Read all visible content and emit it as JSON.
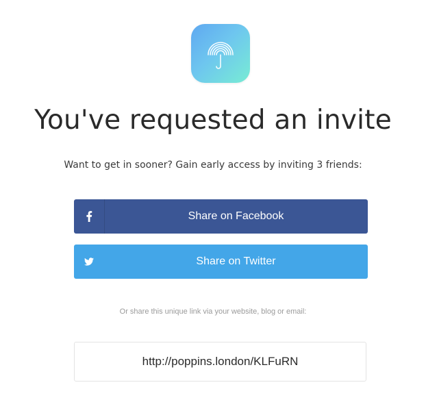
{
  "app": {
    "icon": "umbrella-signal-icon",
    "accent_gradient": [
      "#5fa8f0",
      "#78ecd4"
    ]
  },
  "heading": "You've requested an invite",
  "subtext": "Want to get in sooner? Gain early access by inviting 3 friends:",
  "buttons": {
    "facebook": {
      "label": "Share on Facebook",
      "icon": "facebook-icon",
      "color": "#3b5695"
    },
    "twitter": {
      "label": "Share on Twitter",
      "icon": "twitter-icon",
      "color": "#43a6e8"
    }
  },
  "share_note": "Or share this unique link via your website, blog or email:",
  "unique_link": "http://poppins.london/KLFuRN"
}
